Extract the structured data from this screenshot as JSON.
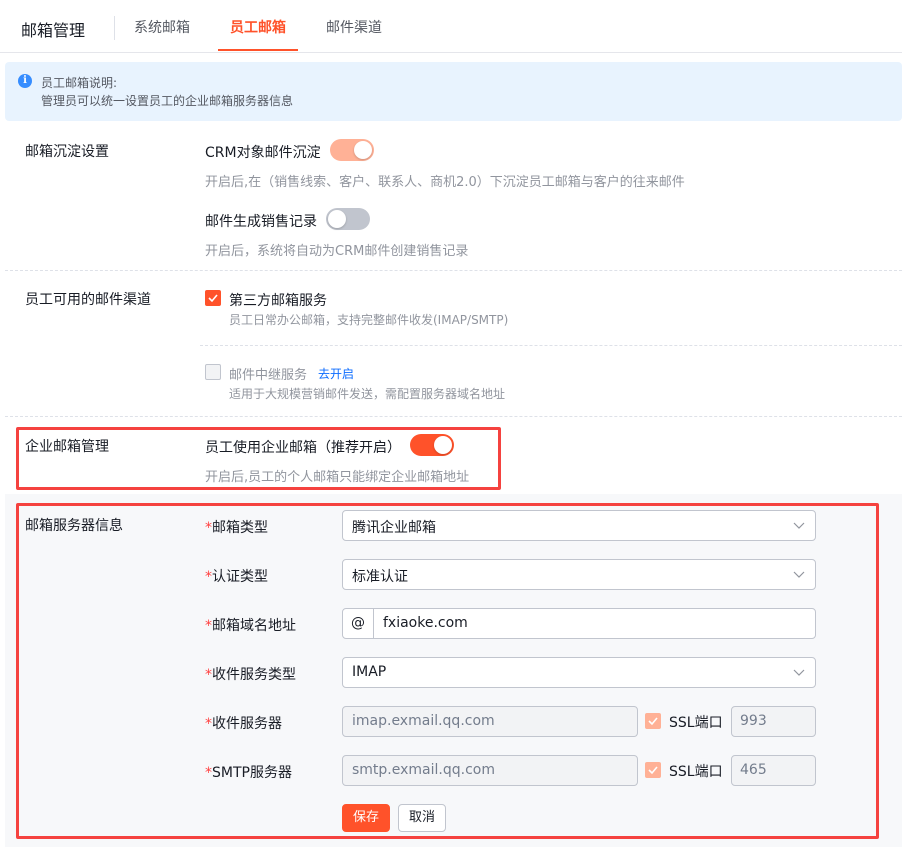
{
  "header": {
    "title": "邮箱管理",
    "tabs": [
      {
        "label": "系统邮箱",
        "active": false
      },
      {
        "label": "员工邮箱",
        "active": true
      },
      {
        "label": "邮件渠道",
        "active": false
      }
    ]
  },
  "info": {
    "title": "员工邮箱说明:",
    "text": "管理员可以统一设置员工的企业邮箱服务器信息"
  },
  "archive": {
    "label": "邮箱沉淀设置",
    "crm_title": "CRM对象邮件沉淀",
    "crm_desc": "开启后,在（销售线索、客户、联系人、商机2.0）下沉淀员工邮箱与客户的往来邮件",
    "sales_title": "邮件生成销售记录",
    "sales_desc": "开启后，系统将自动为CRM邮件创建销售记录"
  },
  "channels": {
    "label": "员工可用的邮件渠道",
    "third_party_title": "第三方邮箱服务",
    "third_party_desc": "员工日常办公邮箱，支持完整邮件收发(IMAP/SMTP)",
    "relay_title": "邮件中继服务",
    "relay_link": "去开启",
    "relay_desc": "适用于大规模营销邮件发送，需配置服务器域名地址"
  },
  "enterprise": {
    "label": "企业邮箱管理",
    "toggle_title": "员工使用企业邮箱（推荐开启）",
    "toggle_desc": "开启后,员工的个人邮箱只能绑定企业邮箱地址"
  },
  "server": {
    "label": "邮箱服务器信息",
    "required_mark": "*",
    "mailbox_type_label": "邮箱类型",
    "mailbox_type_value": "腾讯企业邮箱",
    "auth_type_label": "认证类型",
    "auth_type_value": "标准认证",
    "domain_label": "邮箱域名地址",
    "domain_prefix": "@",
    "domain_value": "fxiaoke.com",
    "incoming_type_label": "收件服务类型",
    "incoming_type_value": "IMAP",
    "incoming_server_label": "收件服务器",
    "incoming_server_value": "imap.exmail.qq.com",
    "smtp_label": "SMTP服务器",
    "smtp_value": "smtp.exmail.qq.com",
    "ssl_label": "SSL端口",
    "incoming_port": "993",
    "smtp_port": "465",
    "save_label": "保存",
    "cancel_label": "取消"
  },
  "colors": {
    "accent": "#ff522a",
    "accent_light": "#ffb196",
    "link": "#0c6cff",
    "highlight_box": "#f5423f",
    "info_bg": "#e8f3fe"
  }
}
